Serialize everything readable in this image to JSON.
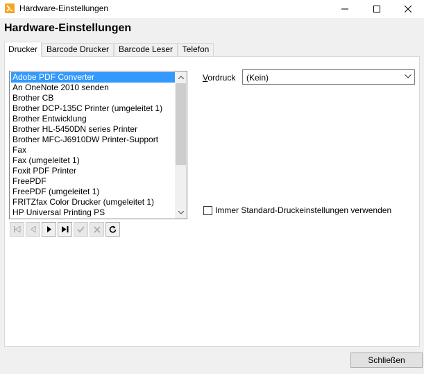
{
  "window": {
    "title": "Hardware-Einstellungen",
    "accent_color": "#f5a623"
  },
  "heading": "Hardware-Einstellungen",
  "tabs": [
    {
      "label": "Drucker",
      "active": true
    },
    {
      "label": "Barcode Drucker",
      "active": false
    },
    {
      "label": "Barcode Leser",
      "active": false
    },
    {
      "label": "Telefon",
      "active": false
    }
  ],
  "printer_list": {
    "selected_index": 0,
    "selection_color": "#3399ff",
    "items": [
      "Adobe PDF Converter",
      "An OneNote 2010 senden",
      "Brother CB",
      "Brother DCP-135C Printer (umgeleitet 1)",
      "Brother Entwicklung",
      "Brother HL-5450DN series Printer",
      "Brother MFC-J6910DW Printer-Support",
      "Fax",
      "Fax (umgeleitet 1)",
      "Foxit PDF Printer",
      "FreePDF",
      "FreePDF (umgeleitet 1)",
      "FRITZfax Color Drucker (umgeleitet 1)",
      "HP Universal Printing PS"
    ]
  },
  "nav_buttons": [
    {
      "icon": "first-record-icon",
      "enabled": false
    },
    {
      "icon": "prior-record-icon",
      "enabled": false
    },
    {
      "icon": "next-record-icon",
      "enabled": true
    },
    {
      "icon": "last-record-icon",
      "enabled": true
    },
    {
      "icon": "post-check-icon",
      "enabled": false
    },
    {
      "icon": "cancel-x-icon",
      "enabled": false
    },
    {
      "icon": "refresh-icon",
      "enabled": true
    }
  ],
  "vordruck": {
    "label_underlined": "V",
    "label_rest": "ordruck",
    "value": "(Kein)"
  },
  "standard_settings": {
    "label": "Immer Standard-Druckeinstellungen verwenden",
    "checked": false
  },
  "close_button": {
    "label": "Schließen"
  }
}
